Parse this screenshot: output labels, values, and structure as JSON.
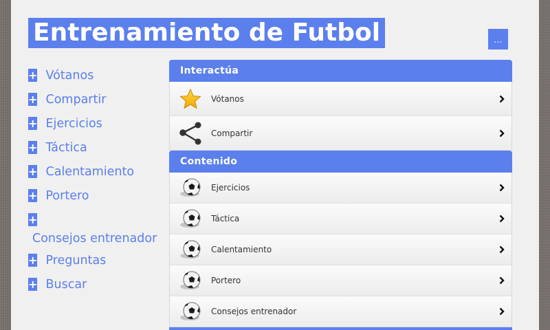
{
  "header": {
    "title": "Entrenamiento de Futbol",
    "menu_label": "..."
  },
  "sidenav": {
    "plus_symbol": "+",
    "items": [
      {
        "label": "Vótanos"
      },
      {
        "label": "Compartir"
      },
      {
        "label": "Ejercicios"
      },
      {
        "label": "Táctica"
      },
      {
        "label": "Calentamiento"
      },
      {
        "label": "Portero"
      },
      {
        "label": "Consejos entrenador"
      },
      {
        "label": "Preguntas"
      },
      {
        "label": "Buscar"
      }
    ]
  },
  "interactua": {
    "heading": "Interactúa",
    "items": [
      {
        "label": "Vótanos",
        "icon": "star-icon"
      },
      {
        "label": "Compartir",
        "icon": "share-icon"
      }
    ]
  },
  "contenido": {
    "heading": "Contenido",
    "items": [
      {
        "label": "Ejercicios",
        "icon": "soccer-ball-icon"
      },
      {
        "label": "Táctica",
        "icon": "soccer-ball-icon"
      },
      {
        "label": "Calentamiento",
        "icon": "soccer-ball-icon"
      },
      {
        "label": "Portero",
        "icon": "soccer-ball-icon"
      },
      {
        "label": "Consejos entrenador",
        "icon": "soccer-ball-icon"
      }
    ]
  },
  "colors": {
    "accent": "#5b7fec",
    "page_background": "#f0f0f0",
    "outer_background": "#76706c"
  }
}
